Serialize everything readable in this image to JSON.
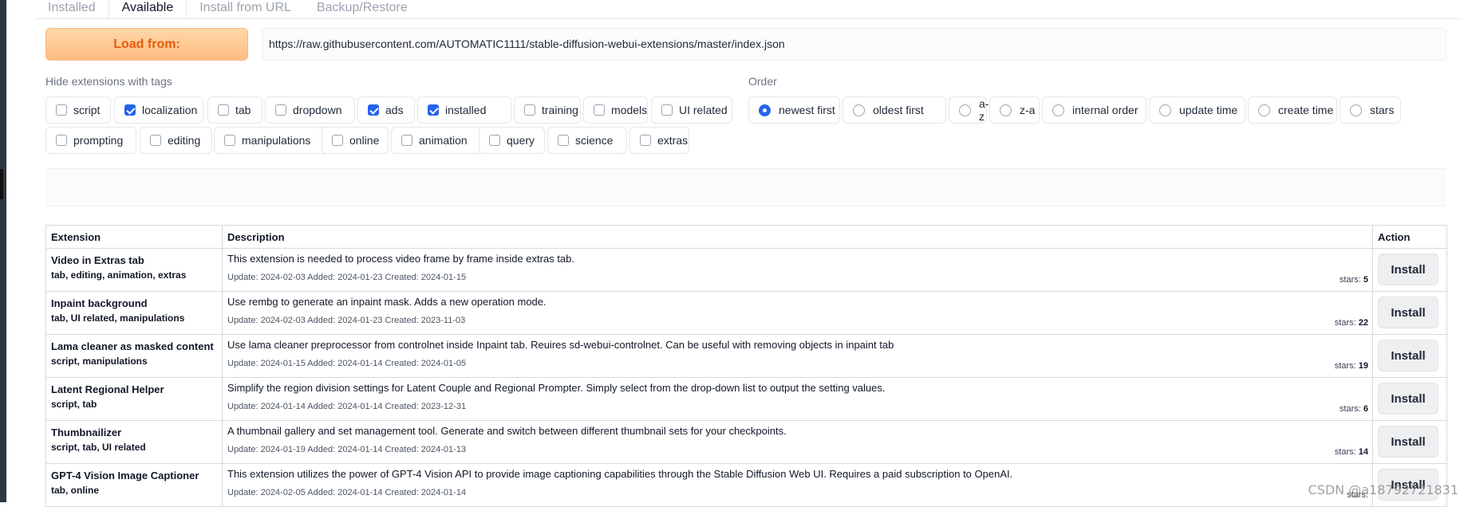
{
  "tabs": [
    {
      "label": "Installed",
      "active": false
    },
    {
      "label": "Available",
      "active": true
    },
    {
      "label": "Install from URL",
      "active": false
    },
    {
      "label": "Backup/Restore",
      "active": false
    }
  ],
  "load": {
    "button_label": "Load from:",
    "url": "https://raw.githubusercontent.com/AUTOMATIC1111/stable-diffusion-webui-extensions/master/index.json"
  },
  "hide_tags": {
    "label": "Hide extensions with tags",
    "options": [
      {
        "label": "script",
        "checked": false
      },
      {
        "label": "localization",
        "checked": true
      },
      {
        "label": "tab",
        "checked": false
      },
      {
        "label": "dropdown",
        "checked": false
      },
      {
        "label": "ads",
        "checked": true
      },
      {
        "label": "installed",
        "checked": true
      },
      {
        "label": "training",
        "checked": false
      },
      {
        "label": "models",
        "checked": false
      },
      {
        "label": "UI related",
        "checked": false
      },
      {
        "label": "prompting",
        "checked": false
      },
      {
        "label": "editing",
        "checked": false
      },
      {
        "label": "manipulations",
        "checked": false
      },
      {
        "label": "online",
        "checked": false
      },
      {
        "label": "animation",
        "checked": false
      },
      {
        "label": "query",
        "checked": false
      },
      {
        "label": "science",
        "checked": false
      },
      {
        "label": "extras",
        "checked": false
      }
    ]
  },
  "order": {
    "label": "Order",
    "options": [
      {
        "label": "newest first",
        "selected": true
      },
      {
        "label": "oldest first",
        "selected": false
      },
      {
        "label": "a-z",
        "selected": false
      },
      {
        "label": "z-a",
        "selected": false
      },
      {
        "label": "internal order",
        "selected": false
      },
      {
        "label": "update time",
        "selected": false
      },
      {
        "label": "create time",
        "selected": false
      },
      {
        "label": "stars",
        "selected": false
      }
    ]
  },
  "table": {
    "headers": [
      "Extension",
      "Description",
      "Action"
    ],
    "rows": [
      {
        "name": "Video in Extras tab",
        "tags": "tab, editing, animation, extras",
        "description": "This extension is needed to process video frame by frame inside extras tab.",
        "meta": "Update: 2024-02-03 Added: 2024-01-23 Created: 2024-01-15",
        "stars_label": "stars:",
        "stars": "5",
        "action": "Install"
      },
      {
        "name": "Inpaint background",
        "tags": "tab, UI related, manipulations",
        "description": "Use rembg to generate an inpaint mask. Adds a new operation mode.",
        "meta": "Update: 2024-02-03 Added: 2024-01-23 Created: 2023-11-03",
        "stars_label": "stars:",
        "stars": "22",
        "action": "Install"
      },
      {
        "name": "Lama cleaner as masked content",
        "tags": "script, manipulations",
        "description": "Use lama cleaner preprocessor from controlnet inside Inpaint tab. Reuires sd-webui-controlnet. Can be useful with removing objects in inpaint tab",
        "meta": "Update: 2024-01-15 Added: 2024-01-14 Created: 2024-01-05",
        "stars_label": "stars:",
        "stars": "19",
        "action": "Install"
      },
      {
        "name": "Latent Regional Helper",
        "tags": "script, tab",
        "description": "Simplify the region division settings for Latent Couple and Regional Prompter. Simply select from the drop-down list to output the setting values.",
        "meta": "Update: 2024-01-14 Added: 2024-01-14 Created: 2023-12-31",
        "stars_label": "stars:",
        "stars": "6",
        "action": "Install"
      },
      {
        "name": "Thumbnailizer",
        "tags": "script, tab, UI related",
        "description": "A thumbnail gallery and set management tool. Generate and switch between different thumbnail sets for your checkpoints.",
        "meta": "Update: 2024-01-19 Added: 2024-01-14 Created: 2024-01-13",
        "stars_label": "stars:",
        "stars": "14",
        "action": "Install"
      },
      {
        "name": "GPT-4 Vision Image Captioner",
        "tags": "tab, online",
        "description": "This extension utilizes the power of GPT-4 Vision API to provide image captioning capabilities through the Stable Diffusion Web UI. Requires a paid subscription to OpenAI.",
        "meta": "Update: 2024-02-05 Added: 2024-01-14 Created: 2024-01-14",
        "stars_label": "stars:",
        "stars": "",
        "action": "Install"
      }
    ]
  },
  "watermark": "CSDN @a18792721831"
}
